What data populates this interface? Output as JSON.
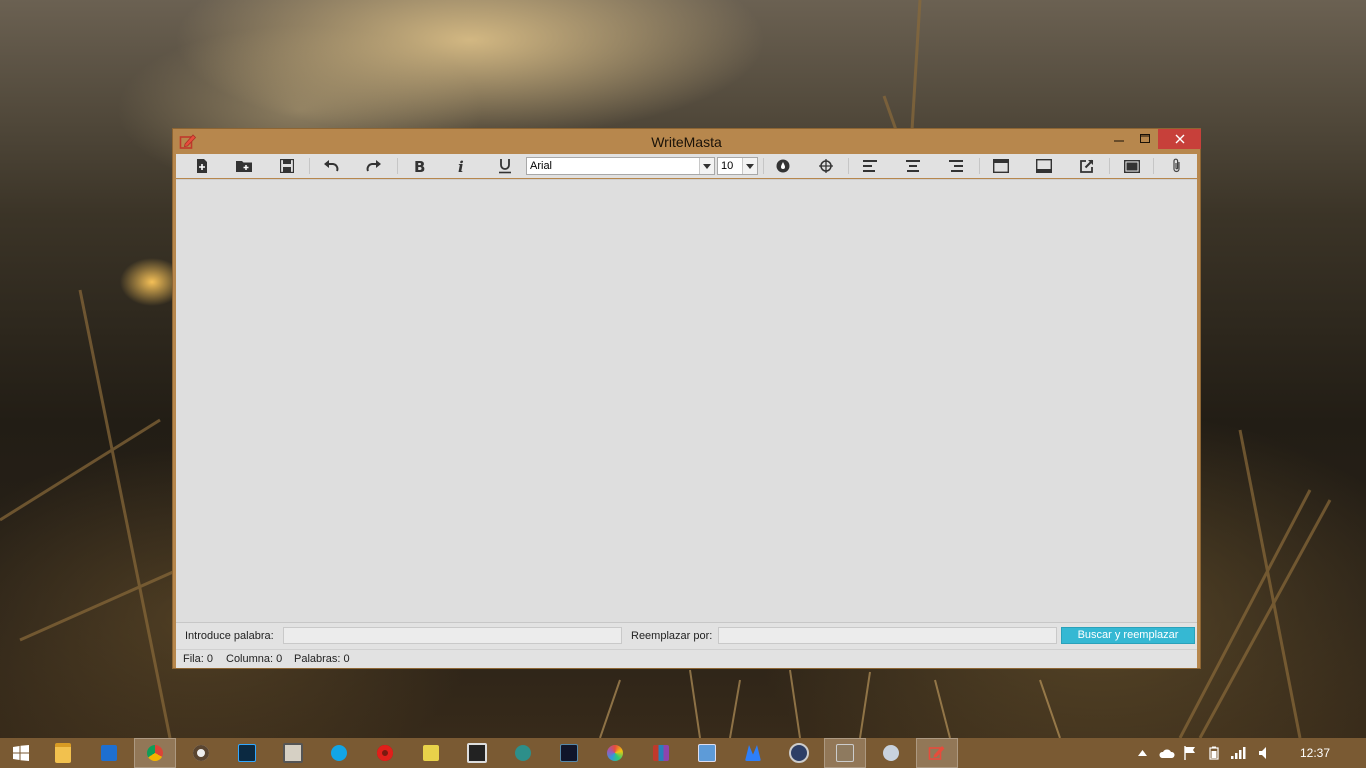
{
  "window": {
    "title": "WriteMasta"
  },
  "toolbar": {
    "buttons": [
      {
        "name": "new-file",
        "icon": "new-file-icon"
      },
      {
        "name": "open-folder",
        "icon": "open-folder-icon"
      },
      {
        "name": "save",
        "icon": "save-icon"
      },
      {
        "name": "undo",
        "icon": "undo-icon"
      },
      {
        "name": "redo",
        "icon": "redo-icon"
      },
      {
        "name": "bold",
        "icon": "bold-icon"
      },
      {
        "name": "italic",
        "icon": "italic-icon"
      },
      {
        "name": "underline",
        "icon": "underline-icon"
      },
      {
        "name": "color",
        "icon": "ink-drop-icon"
      },
      {
        "name": "target",
        "icon": "crosshair-icon"
      },
      {
        "name": "align-left",
        "icon": "align-left-icon"
      },
      {
        "name": "align-center",
        "icon": "align-center-icon"
      },
      {
        "name": "align-right",
        "icon": "align-right-icon"
      },
      {
        "name": "window-top",
        "icon": "window-top-icon"
      },
      {
        "name": "window-bottom",
        "icon": "window-bottom-icon"
      },
      {
        "name": "export",
        "icon": "external-link-icon"
      },
      {
        "name": "fullscreen",
        "icon": "fullscreen-icon"
      },
      {
        "name": "attach",
        "icon": "paperclip-icon"
      }
    ],
    "font_family": "Arial",
    "font_size": "10"
  },
  "find_bar": {
    "search_label": "Introduce palabra:",
    "search_value": "",
    "replace_label": "Reemplazar por:",
    "replace_value": "",
    "button_label": "Buscar y reemplazar"
  },
  "status": {
    "row": "Fila: 0",
    "column": "Columna: 0",
    "words": "Palabras: 0"
  },
  "taskbar": {
    "time": "12:37",
    "apps": [
      "start",
      "file-explorer",
      "mail",
      "chrome",
      "steam",
      "photoshop",
      "app",
      "skype",
      "opera",
      "app",
      "unity",
      "app",
      "app",
      "app",
      "app",
      "virtualbox",
      "malwarebytes",
      "app",
      "jetbrains",
      "app",
      "writemasta"
    ]
  },
  "colors": {
    "window_frame": "#b7874d",
    "close_button": "#c7403a",
    "accent_button": "#35b8d3",
    "taskbar": "#7a5a33"
  }
}
